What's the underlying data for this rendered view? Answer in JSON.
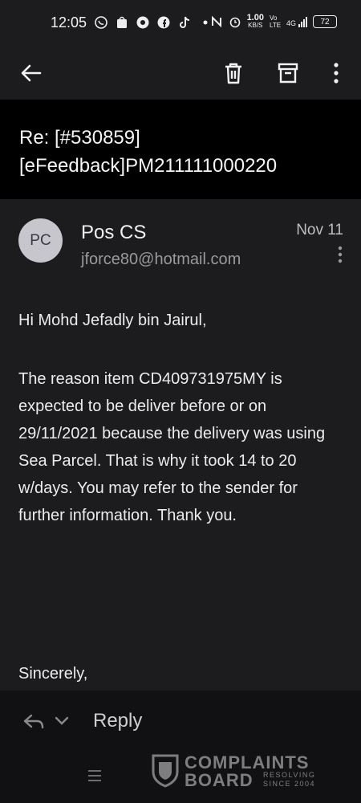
{
  "status_bar": {
    "time": "12:05",
    "icons": [
      "whatsapp-icon",
      "shopee-icon",
      "chrome-icon",
      "facebook-icon",
      "tiktok-icon",
      "dot-icon",
      "nfc-icon",
      "alarm-icon"
    ],
    "network_speed": "1.00",
    "network_unit": "KB/S",
    "volte": "Vo LTE",
    "signal": "4G",
    "battery": "72"
  },
  "app_bar": {
    "back_icon": "arrow-left-icon",
    "delete_icon": "trash-icon",
    "archive_icon": "archive-icon",
    "more_icon": "more-vertical-icon"
  },
  "email": {
    "subject": "Re: [#530859]\n[eFeedback]PM211111000220",
    "avatar_initials": "PC",
    "sender_name": "Pos CS",
    "sender_email": "jforce80@hotmail.com",
    "date": "Nov 11",
    "greeting": "Hi Mohd Jefadly bin Jairul,",
    "body": "The reason item CD409731975MY is expected to be deliver before or on 29/11/2021 because the delivery was using Sea Parcel. That is why it took 14 to 20 w/days. You may refer to the sender for further information. Thank you.",
    "signoff": "Sincerely,"
  },
  "bottom_bar": {
    "reply_label": "Reply"
  },
  "watermark": {
    "line1": "COMPLAINTS",
    "line2": "BOARD",
    "tag1": "RESOLVING",
    "tag2": "SINCE 2004"
  },
  "colors": {
    "background": "#1c1c1e",
    "subject_background": "#000000",
    "avatar": "#c7c6cd",
    "secondary_text": "#9a9a9a"
  }
}
